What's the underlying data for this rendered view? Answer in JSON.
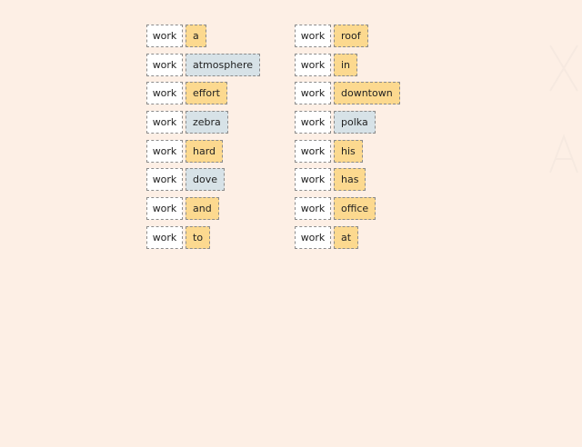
{
  "left_column": [
    {
      "left": "work",
      "right": "a",
      "color": "yellow"
    },
    {
      "left": "work",
      "right": "atmosphere",
      "color": "blue"
    },
    {
      "left": "work",
      "right": "effort",
      "color": "yellow"
    },
    {
      "left": "work",
      "right": "zebra",
      "color": "blue"
    },
    {
      "left": "work",
      "right": "hard",
      "color": "yellow"
    },
    {
      "left": "work",
      "right": "dove",
      "color": "blue"
    },
    {
      "left": "work",
      "right": "and",
      "color": "yellow"
    },
    {
      "left": "work",
      "right": "to",
      "color": "yellow"
    }
  ],
  "right_column": [
    {
      "left": "work",
      "right": "roof",
      "color": "yellow"
    },
    {
      "left": "work",
      "right": "in",
      "color": "yellow"
    },
    {
      "left": "work",
      "right": "downtown",
      "color": "yellow"
    },
    {
      "left": "work",
      "right": "polka",
      "color": "blue"
    },
    {
      "left": "work",
      "right": "his",
      "color": "yellow"
    },
    {
      "left": "work",
      "right": "has",
      "color": "yellow"
    },
    {
      "left": "work",
      "right": "office",
      "color": "yellow"
    },
    {
      "left": "work",
      "right": "at",
      "color": "yellow"
    }
  ],
  "colors": {
    "background": "#fdefe5",
    "yellow": "#fcd98f",
    "blue": "#d7e2e7",
    "white": "#ffffff",
    "border": "#8b8b8b"
  }
}
